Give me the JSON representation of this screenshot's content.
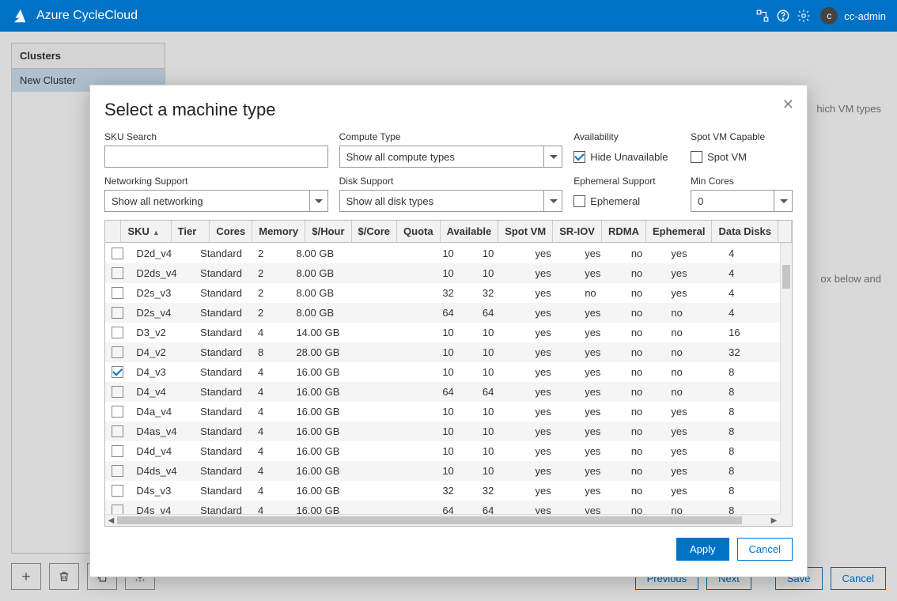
{
  "header": {
    "product": "Azure CycleCloud",
    "user_initial": "c",
    "username": "cc-admin"
  },
  "sidebar": {
    "title": "Clusters",
    "items": [
      "New Cluster"
    ]
  },
  "background_hints": {
    "right1": "hich VM types",
    "right2": "ox below and"
  },
  "footer": {
    "previous": "Previous",
    "next": "Next",
    "save": "Save",
    "cancel": "Cancel"
  },
  "modal": {
    "title": "Select a machine type",
    "filters": {
      "sku_search_label": "SKU Search",
      "sku_search_value": "",
      "compute_type_label": "Compute Type",
      "compute_type_value": "Show all compute types",
      "availability_label": "Availability",
      "hide_unavailable_label": "Hide Unavailable",
      "hide_unavailable_checked": true,
      "spot_capable_label": "Spot VM Capable",
      "spot_vm_label": "Spot VM",
      "spot_vm_checked": false,
      "networking_label": "Networking Support",
      "networking_value": "Show all networking",
      "disk_label": "Disk Support",
      "disk_value": "Show all disk types",
      "ephemeral_support_label": "Ephemeral Support",
      "ephemeral_label": "Ephemeral",
      "ephemeral_checked": false,
      "min_cores_label": "Min Cores",
      "min_cores_value": "0"
    },
    "columns": [
      "SKU",
      "Tier",
      "Cores",
      "Memory",
      "$/Hour",
      "$/Core",
      "Quota",
      "Available",
      "Spot VM",
      "SR-IOV",
      "RDMA",
      "Ephemeral",
      "Data Disks"
    ],
    "rows": [
      {
        "checked": false,
        "sku": "D2d_v4",
        "tier": "Standard",
        "cores": "2",
        "memory": "8.00 GB",
        "hour": "",
        "core": "",
        "quota": "10",
        "available": "10",
        "spot": "yes",
        "sriov": "yes",
        "rdma": "no",
        "ephemeral": "yes",
        "disks": "4"
      },
      {
        "checked": false,
        "sku": "D2ds_v4",
        "tier": "Standard",
        "cores": "2",
        "memory": "8.00 GB",
        "hour": "",
        "core": "",
        "quota": "10",
        "available": "10",
        "spot": "yes",
        "sriov": "yes",
        "rdma": "no",
        "ephemeral": "yes",
        "disks": "4"
      },
      {
        "checked": false,
        "sku": "D2s_v3",
        "tier": "Standard",
        "cores": "2",
        "memory": "8.00 GB",
        "hour": "",
        "core": "",
        "quota": "32",
        "available": "32",
        "spot": "yes",
        "sriov": "no",
        "rdma": "no",
        "ephemeral": "yes",
        "disks": "4"
      },
      {
        "checked": false,
        "sku": "D2s_v4",
        "tier": "Standard",
        "cores": "2",
        "memory": "8.00 GB",
        "hour": "",
        "core": "",
        "quota": "64",
        "available": "64",
        "spot": "yes",
        "sriov": "yes",
        "rdma": "no",
        "ephemeral": "no",
        "disks": "4"
      },
      {
        "checked": false,
        "sku": "D3_v2",
        "tier": "Standard",
        "cores": "4",
        "memory": "14.00 GB",
        "hour": "",
        "core": "",
        "quota": "10",
        "available": "10",
        "spot": "yes",
        "sriov": "yes",
        "rdma": "no",
        "ephemeral": "no",
        "disks": "16"
      },
      {
        "checked": false,
        "sku": "D4_v2",
        "tier": "Standard",
        "cores": "8",
        "memory": "28.00 GB",
        "hour": "",
        "core": "",
        "quota": "10",
        "available": "10",
        "spot": "yes",
        "sriov": "yes",
        "rdma": "no",
        "ephemeral": "no",
        "disks": "32"
      },
      {
        "checked": true,
        "sku": "D4_v3",
        "tier": "Standard",
        "cores": "4",
        "memory": "16.00 GB",
        "hour": "",
        "core": "",
        "quota": "10",
        "available": "10",
        "spot": "yes",
        "sriov": "yes",
        "rdma": "no",
        "ephemeral": "no",
        "disks": "8"
      },
      {
        "checked": false,
        "sku": "D4_v4",
        "tier": "Standard",
        "cores": "4",
        "memory": "16.00 GB",
        "hour": "",
        "core": "",
        "quota": "64",
        "available": "64",
        "spot": "yes",
        "sriov": "yes",
        "rdma": "no",
        "ephemeral": "no",
        "disks": "8"
      },
      {
        "checked": false,
        "sku": "D4a_v4",
        "tier": "Standard",
        "cores": "4",
        "memory": "16.00 GB",
        "hour": "",
        "core": "",
        "quota": "10",
        "available": "10",
        "spot": "yes",
        "sriov": "yes",
        "rdma": "no",
        "ephemeral": "yes",
        "disks": "8"
      },
      {
        "checked": false,
        "sku": "D4as_v4",
        "tier": "Standard",
        "cores": "4",
        "memory": "16.00 GB",
        "hour": "",
        "core": "",
        "quota": "10",
        "available": "10",
        "spot": "yes",
        "sriov": "yes",
        "rdma": "no",
        "ephemeral": "yes",
        "disks": "8"
      },
      {
        "checked": false,
        "sku": "D4d_v4",
        "tier": "Standard",
        "cores": "4",
        "memory": "16.00 GB",
        "hour": "",
        "core": "",
        "quota": "10",
        "available": "10",
        "spot": "yes",
        "sriov": "yes",
        "rdma": "no",
        "ephemeral": "yes",
        "disks": "8"
      },
      {
        "checked": false,
        "sku": "D4ds_v4",
        "tier": "Standard",
        "cores": "4",
        "memory": "16.00 GB",
        "hour": "",
        "core": "",
        "quota": "10",
        "available": "10",
        "spot": "yes",
        "sriov": "yes",
        "rdma": "no",
        "ephemeral": "yes",
        "disks": "8"
      },
      {
        "checked": false,
        "sku": "D4s_v3",
        "tier": "Standard",
        "cores": "4",
        "memory": "16.00 GB",
        "hour": "",
        "core": "",
        "quota": "32",
        "available": "32",
        "spot": "yes",
        "sriov": "yes",
        "rdma": "no",
        "ephemeral": "yes",
        "disks": "8"
      },
      {
        "checked": false,
        "sku": "D4s_v4",
        "tier": "Standard",
        "cores": "4",
        "memory": "16.00 GB",
        "hour": "",
        "core": "",
        "quota": "64",
        "available": "64",
        "spot": "yes",
        "sriov": "yes",
        "rdma": "no",
        "ephemeral": "no",
        "disks": "8"
      }
    ],
    "apply": "Apply",
    "cancel": "Cancel"
  }
}
